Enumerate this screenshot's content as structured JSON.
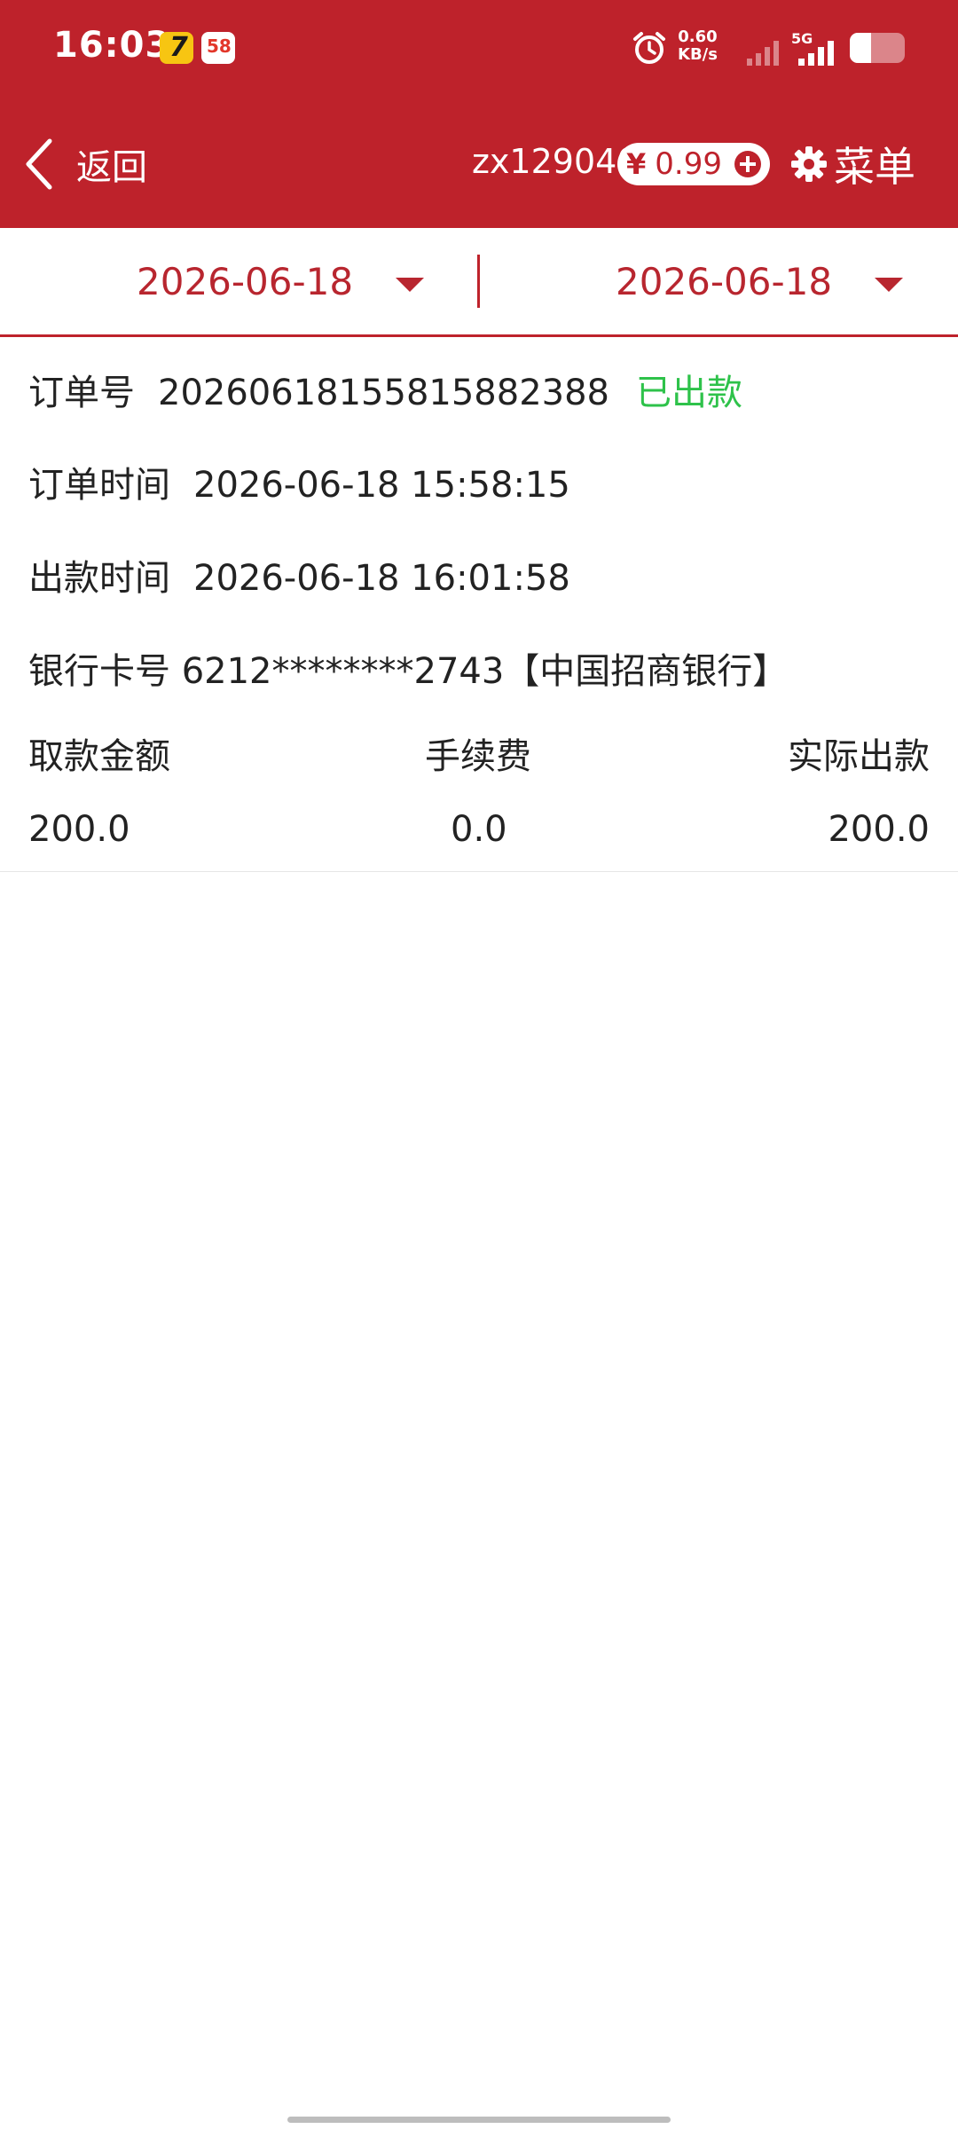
{
  "status_bar": {
    "time": "16:03",
    "app_icon_1": "7",
    "app_icon_2": "58",
    "net_speed_value": "0.60",
    "net_speed_unit": "KB/s",
    "network_type": "5G",
    "battery_level": 0.35
  },
  "header": {
    "back_label": "返回",
    "user_id": "zx129040",
    "currency_symbol": "¥",
    "balance": "0.99",
    "menu_label": "菜单",
    "icons": [
      "chevron-left-icon",
      "plus-circle-icon",
      "gear-icon"
    ]
  },
  "date_filter": {
    "start_date": "2026-06-18",
    "end_date": "2026-06-18"
  },
  "order": {
    "order_no_label": "订单号",
    "order_no": "20260618155815882388",
    "status": "已出款",
    "order_time_label": "订单时间",
    "order_time": "2026-06-18 15:58:15",
    "payout_time_label": "出款时间",
    "payout_time": "2026-06-18 16:01:58",
    "bank_card": "银行卡号 6212********2743【中国招商银行】",
    "columns": [
      "取款金额",
      "手续费",
      "实际出款"
    ],
    "values": [
      "200.0",
      "0.0",
      "200.0"
    ]
  },
  "colors": {
    "primary_red": "#be222b",
    "status_green": "#2ec24a"
  }
}
